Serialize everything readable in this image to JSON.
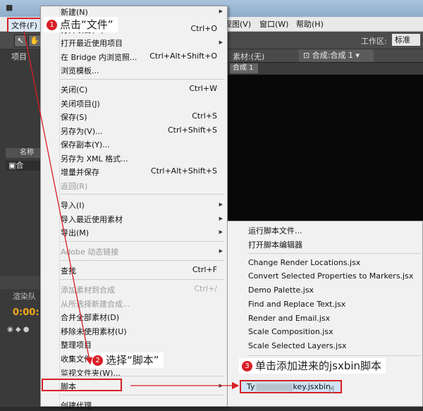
{
  "menubar": {
    "file_label": "文件(F)",
    "view_label": "视图(V)",
    "window_label": "窗口(W)",
    "help_label": "帮助(H)"
  },
  "toolbar": {
    "workspace_label": "工作区:",
    "workspace_value": "标准"
  },
  "left_panel": {
    "project_tab": "项目",
    "name_col": "名称",
    "item": "合",
    "render_queue": "渲染队",
    "time": "0:00:"
  },
  "comp_panel": {
    "footage_tab": "素材:(无)",
    "comp_tab": "合成:合成 1",
    "comp_sub_tab": "合成 1"
  },
  "file_menu": {
    "items": [
      {
        "label": "新建(N)",
        "shortcut": "",
        "disabled": false
      },
      {
        "label": "打开项目(O)...",
        "shortcut": "Ctrl+O",
        "disabled": false
      },
      {
        "label": "打开最近使用项目",
        "shortcut": "",
        "disabled": false
      },
      {
        "label": "在 Bridge 内浏览照...",
        "shortcut": "Ctrl+Alt+Shift+O",
        "disabled": false
      },
      {
        "label": "浏览模板...",
        "shortcut": "",
        "disabled": false
      },
      {
        "label": "关闭(C)",
        "shortcut": "Ctrl+W",
        "disabled": false
      },
      {
        "label": "关闭项目(J)",
        "shortcut": "",
        "disabled": false
      },
      {
        "label": "保存(S)",
        "shortcut": "Ctrl+S",
        "disabled": false
      },
      {
        "label": "另存为(V)...",
        "shortcut": "Ctrl+Shift+S",
        "disabled": false
      },
      {
        "label": "保存副本(Y)...",
        "shortcut": "",
        "disabled": false
      },
      {
        "label": "另存为 XML 格式...",
        "shortcut": "",
        "disabled": false
      },
      {
        "label": "增量并保存",
        "shortcut": "Ctrl+Alt+Shift+S",
        "disabled": false
      },
      {
        "label": "返回(R)",
        "shortcut": "",
        "disabled": true
      },
      {
        "label": "导入(I)",
        "shortcut": "",
        "disabled": false
      },
      {
        "label": "导入最近使用素材",
        "shortcut": "",
        "disabled": false
      },
      {
        "label": "导出(M)",
        "shortcut": "",
        "disabled": false
      },
      {
        "label": "Adobe 动态链接",
        "shortcut": "",
        "disabled": true
      },
      {
        "label": "查找",
        "shortcut": "Ctrl+F",
        "disabled": false
      },
      {
        "label": "添加素材到合成",
        "shortcut": "Ctrl+/",
        "disabled": true
      },
      {
        "label": "从所选择新建合成...",
        "shortcut": "",
        "disabled": true
      },
      {
        "label": "合并全部素材(D)",
        "shortcut": "",
        "disabled": false
      },
      {
        "label": "移除未使用素材(U)",
        "shortcut": "",
        "disabled": false
      },
      {
        "label": "整理项目",
        "shortcut": "",
        "disabled": false
      },
      {
        "label": "收集文件...",
        "shortcut": "",
        "disabled": false
      },
      {
        "label": "监视文件夹(W)...",
        "shortcut": "",
        "disabled": false
      },
      {
        "label": "脚本",
        "shortcut": "",
        "disabled": false
      },
      {
        "label": "创建代理",
        "shortcut": "",
        "disabled": false
      }
    ]
  },
  "scripts_submenu": {
    "items": [
      {
        "label": "运行脚本文件..."
      },
      {
        "label": "打开脚本编辑器"
      },
      {
        "label": "Change Render Locations.jsx"
      },
      {
        "label": "Convert Selected Properties to Markers.jsx"
      },
      {
        "label": "Demo Palette.jsx"
      },
      {
        "label": "Find and Replace Text.jsx"
      },
      {
        "label": "Render and Email.jsx"
      },
      {
        "label": "Scale Composition.jsx"
      },
      {
        "label": "Scale Selected Layers.jsx"
      }
    ],
    "highlighted_prefix": "Ty",
    "highlighted_suffix": "key.jsxbin"
  },
  "annotations": [
    {
      "number": "1",
      "text": "点击“文件”"
    },
    {
      "number": "2",
      "text": "选择“脚本”"
    },
    {
      "number": "3",
      "text": "单击添加进来的jsxbin脚本"
    }
  ],
  "colors": {
    "accent_red": "#d81f26",
    "menu_bg": "#f1f1f1",
    "timecode": "#f3a81a"
  }
}
